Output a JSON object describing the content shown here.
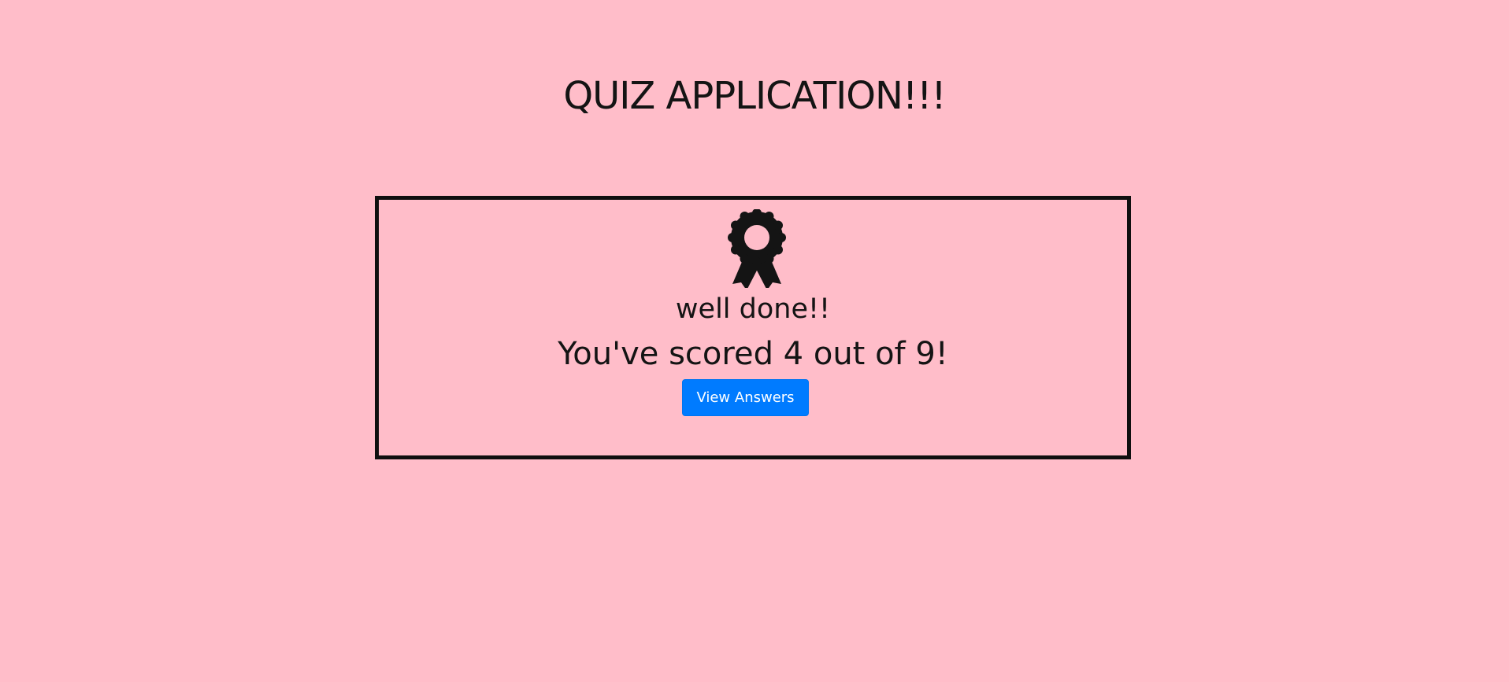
{
  "app": {
    "title": "QUIZ APPLICATION!!!"
  },
  "result": {
    "icon": "award-ribbon-icon",
    "message": "well done!!",
    "score_text": "You've scored 4 out of 9!",
    "score": 4,
    "total": 9,
    "view_answers_label": "View Answers"
  },
  "colors": {
    "background": "#ffbdc9",
    "text": "#141414",
    "border": "#0f0f0f",
    "button": "#007bff",
    "button_text": "#ffffff"
  }
}
